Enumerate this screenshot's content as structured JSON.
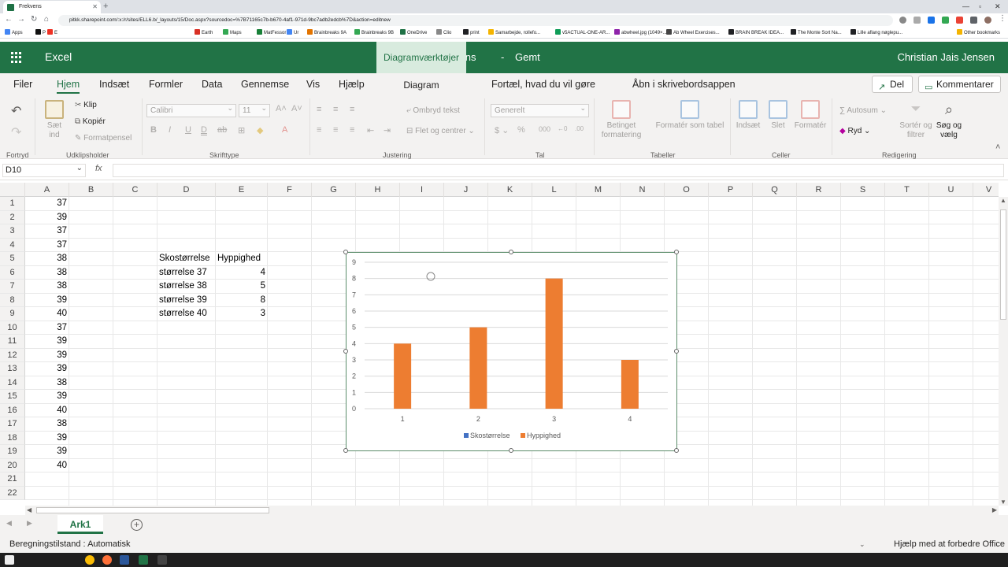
{
  "browser": {
    "tab_title": "Frekvens",
    "url": "pitkk.sharepoint.com/:x:/r/sites/ELL6.b/_layouts/15/Doc.aspx?sourcedoc=%7B71165c7b-b670-4af1-971d-9bc7adb2edcb%7D&action=editnew",
    "bookmarks": [
      "Apps",
      "P",
      "E",
      "Earth",
      "Maps",
      "MatFessor",
      "Ur",
      "Brainbreaks 9A",
      "Brainbreaks 9B",
      "OneDrive",
      "Clio",
      "print",
      "Samarbejde, rollefo...",
      "v5ACTUAL-ONE-AR...",
      "abwheel.jpg (1049×...",
      "Ab Wheel Exercises...",
      "BRAIN BREAK IDEA...",
      "The Monte Sort Na...",
      "Lille aflang nøglepu...",
      "Other bookmarks"
    ],
    "bookmark_colors": [
      "#4285f4",
      "#111111",
      "#ee3124",
      "#d93025",
      "#34a853",
      "#188038",
      "#4285f4",
      "#e37400",
      "#34a853",
      "#1e7145",
      "#888888",
      "#202124",
      "#f4b400",
      "#0f9d58",
      "#8e24aa",
      "#444444",
      "#202124",
      "#202124",
      "#202124",
      "#f4b400"
    ]
  },
  "app": {
    "name": "Excel",
    "doc_name": "Frekvens",
    "doc_separator": "-",
    "doc_status": "Gemt",
    "user": "Christian Jais Jensen",
    "context_tools": "Diagramværktøjer",
    "context_tab": "Diagram"
  },
  "ribbon_tabs": [
    "Filer",
    "Hjem",
    "Indsæt",
    "Formler",
    "Data",
    "Gennemse",
    "Vis",
    "Hjælp"
  ],
  "active_tab": "Hjem",
  "tell_me": "Fortæl, hvad du vil gøre",
  "open_desktop": "Åbn i skrivebordsappen",
  "share_button": "Del",
  "comments_button": "Kommentarer",
  "ribbon": {
    "clipboard": {
      "paste": "Sæt ind",
      "cut": "Klip",
      "copy": "Kopiér",
      "format_painter": "Formatpensel"
    },
    "font": {
      "name": "Calibri",
      "size": "11"
    },
    "alignment": {
      "wrap": "Ombryd tekst",
      "merge": "Flet og centrer"
    },
    "number": {
      "format": "Generelt"
    },
    "tables": {
      "conditional": "Betinget formatering",
      "format_table": "Formatér som tabel"
    },
    "cells": {
      "insert": "Indsæt",
      "delete": "Slet",
      "format": "Formatér"
    },
    "editing": {
      "autosum": "Autosum",
      "clear": "Ryd",
      "sort": "Sortér og filtrer",
      "find": "Søg og vælg"
    },
    "groups": [
      "Fortryd",
      "Udklipsholder",
      "Skrifttype",
      "Justering",
      "Tal",
      "Tabeller",
      "Celler",
      "Redigering"
    ]
  },
  "formula_bar": {
    "name_box": "D10",
    "fx": "fx",
    "formula": ""
  },
  "columns": [
    "A",
    "B",
    "C",
    "D",
    "E",
    "F",
    "G",
    "H",
    "I",
    "J",
    "K",
    "L",
    "M",
    "N",
    "O",
    "P",
    "Q",
    "R",
    "S",
    "T",
    "U",
    "V"
  ],
  "rows": [
    "1",
    "2",
    "3",
    "4",
    "5",
    "6",
    "7",
    "8",
    "9",
    "10",
    "11",
    "12",
    "13",
    "14",
    "15",
    "16",
    "17",
    "18",
    "19",
    "20",
    "21",
    "22"
  ],
  "column_a": [
    "37",
    "39",
    "37",
    "37",
    "38",
    "38",
    "38",
    "39",
    "40",
    "37",
    "39",
    "39",
    "39",
    "38",
    "39",
    "40",
    "38",
    "39",
    "39",
    "40"
  ],
  "table": {
    "header": [
      "Skostørrelse",
      "Hyppighed"
    ],
    "rows": [
      [
        "størrelse 37",
        "4"
      ],
      [
        "størrelse 38",
        "5"
      ],
      [
        "størrelse 39",
        "8"
      ],
      [
        "størrelse 40",
        "3"
      ]
    ]
  },
  "chart_data": {
    "type": "bar",
    "title": "",
    "categories": [
      "1",
      "2",
      "3",
      "4"
    ],
    "series": [
      {
        "name": "Skostørrelse",
        "values": [
          0,
          0,
          0,
          0
        ],
        "color": "#4472c4"
      },
      {
        "name": "Hyppighed",
        "values": [
          4,
          5,
          8,
          3
        ],
        "color": "#ed7d31"
      }
    ],
    "ylim": [
      0,
      9
    ],
    "yticks": [
      "0",
      "1",
      "2",
      "3",
      "4",
      "5",
      "6",
      "7",
      "8",
      "9"
    ],
    "grid": true,
    "legend": "bottom",
    "xlabel": "",
    "ylabel": ""
  },
  "sheet_tab": "Ark1",
  "status": {
    "calc": "Beregningstilstand : Automatisk",
    "help": "Hjælp med at forbedre Office"
  },
  "colors": {
    "excel_green": "#217346",
    "selection_border": "#5b8c6a"
  }
}
